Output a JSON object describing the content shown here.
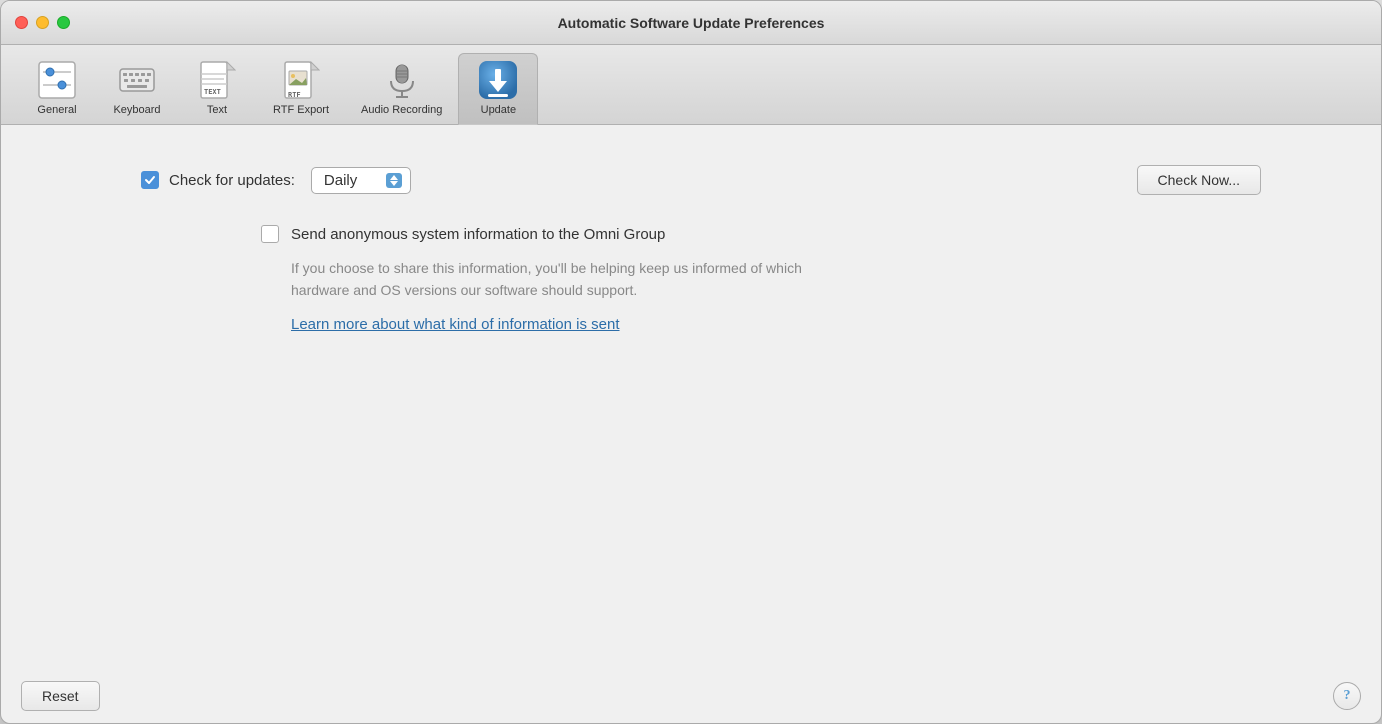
{
  "window": {
    "title": "Automatic Software Update Preferences"
  },
  "toolbar": {
    "items": [
      {
        "id": "general",
        "label": "General",
        "active": false
      },
      {
        "id": "keyboard",
        "label": "Keyboard",
        "active": false
      },
      {
        "id": "text",
        "label": "Text",
        "active": false
      },
      {
        "id": "rtf-export",
        "label": "RTF Export",
        "active": false
      },
      {
        "id": "audio-recording",
        "label": "Audio Recording",
        "active": false
      },
      {
        "id": "update",
        "label": "Update",
        "active": true
      }
    ]
  },
  "main": {
    "check_updates_label": "Check for updates:",
    "check_updates_checked": true,
    "frequency_value": "Daily",
    "check_now_label": "Check Now...",
    "anon_label": "Send anonymous system information to the Omni Group",
    "anon_checked": false,
    "anon_description": "If you choose to share this information, you'll be helping keep us informed of which hardware and OS versions our software should support.",
    "anon_link": "Learn more about what kind of information is sent"
  },
  "bottom": {
    "reset_label": "Reset",
    "help_label": "?"
  }
}
